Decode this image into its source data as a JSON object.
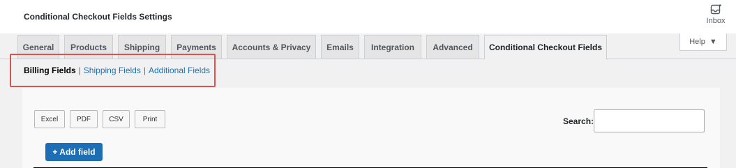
{
  "header": {
    "title": "Conditional Checkout Fields Settings",
    "inbox_label": "Inbox",
    "inbox_icon": "inbox-icon"
  },
  "tabs": [
    {
      "label": "General"
    },
    {
      "label": "Products"
    },
    {
      "label": "Shipping"
    },
    {
      "label": "Payments"
    },
    {
      "label": "Accounts & Privacy"
    },
    {
      "label": "Emails"
    },
    {
      "label": "Integration"
    },
    {
      "label": "Advanced"
    },
    {
      "label": "Conditional Checkout Fields",
      "active": true
    }
  ],
  "help": {
    "label": "Help",
    "icon": "caret-down-icon"
  },
  "subnav": {
    "current": "Billing Fields",
    "links": [
      "Shipping Fields",
      "Additional Fields"
    ],
    "separator": "|"
  },
  "export_buttons": [
    "Excel",
    "PDF",
    "CSV",
    "Print"
  ],
  "search": {
    "label": "Search:",
    "value": ""
  },
  "add_button": {
    "label": "+ Add field"
  },
  "colors": {
    "link": "#2271b1",
    "primary_button": "#1e6eb5",
    "highlight_border": "#d9534f"
  }
}
